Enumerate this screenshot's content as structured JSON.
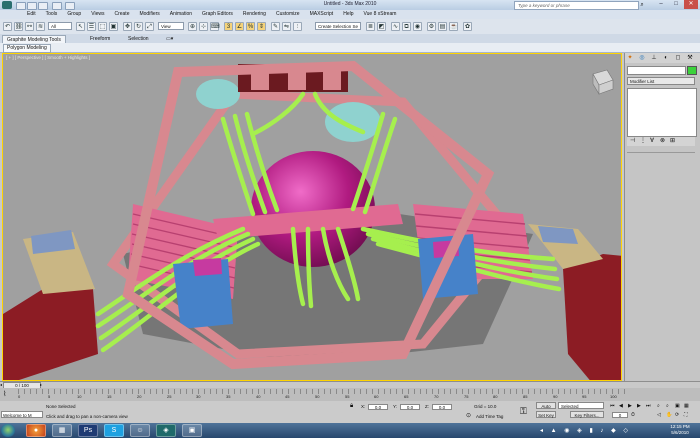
{
  "window": {
    "title": "Untitled - 3ds Max 2010",
    "search_placeholder": "Type a keyword or phrase",
    "min": "–",
    "max": "□",
    "close": "✕"
  },
  "menu": [
    "Edit",
    "Tools",
    "Group",
    "Views",
    "Create",
    "Modifiers",
    "Animation",
    "Graph Editors",
    "Rendering",
    "Customize",
    "MAXScript",
    "Help",
    "Vue 8 xStream"
  ],
  "toolbar": {
    "selection_filter": "All",
    "ref_coord": "View",
    "named_selection": "Create Selection Se"
  },
  "ribbon": {
    "tabs": [
      "Graphite Modeling Tools",
      "Freeform",
      "Selection"
    ],
    "sub": "Polygon Modeling"
  },
  "viewport": {
    "label": "[ + ] [ Perspective ] [ Smooth + Highlights ]",
    "colors": {
      "frame": "#d8888f",
      "tubes": "#a6ef4e",
      "sphere": "#c0208a",
      "box": "#4682c9",
      "base": "#8c1c24",
      "bg": "#a0a0a0"
    }
  },
  "command_panel": {
    "modifier_list": "Modifier List",
    "icons": [
      "create-icon",
      "modify-icon",
      "hierarchy-icon",
      "motion-icon",
      "display-icon",
      "utilities-icon"
    ]
  },
  "timeline": {
    "slider": "0 / 100",
    "ticks": [
      "0",
      "5",
      "10",
      "15",
      "20",
      "25",
      "30",
      "35",
      "40",
      "45",
      "50",
      "55",
      "60",
      "65",
      "70",
      "75",
      "80",
      "85",
      "90",
      "95",
      "100"
    ]
  },
  "status": {
    "maxscript": "Welcome to M",
    "selection": "None Selected",
    "prompt": "Click and drag to pan a non-camera view",
    "x_label": "X:",
    "x_value": "0.0",
    "y_label": "Y:",
    "y_value": "0.0",
    "z_label": "Z:",
    "z_value": "0.0",
    "grid": "Grid = 10.0",
    "add_time_tag": "Add Time Tag",
    "auto_key": "Auto Key",
    "set_key": "Set Key",
    "key_mode": "Selected",
    "key_filters": "Key Filters...",
    "frame": "0"
  },
  "taskbar": {
    "time": "12:15 PM",
    "date": "5/6/2010"
  }
}
